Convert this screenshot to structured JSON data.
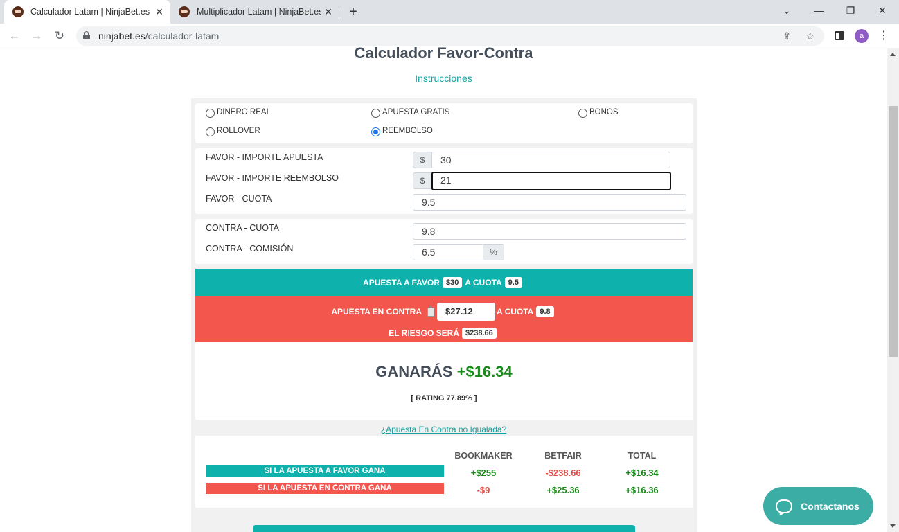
{
  "browser": {
    "tabs": [
      {
        "title": "Calculador Latam | NinjaBet.es",
        "close": "✕"
      },
      {
        "title": "Multiplicador Latam | NinjaBet.es",
        "close": "✕"
      }
    ],
    "new_tab": "+",
    "url_host": "ninjabet.es",
    "url_path": "/calculador-latam",
    "avatar_letter": "a"
  },
  "page": {
    "title": "Calculador Favor-Contra",
    "instructions_link": "Instrucciones",
    "bet_types": [
      {
        "label": "DINERO REAL",
        "checked": false
      },
      {
        "label": "APUESTA GRATIS",
        "checked": false
      },
      {
        "label": "BONOS",
        "checked": false
      },
      {
        "label": "ROLLOVER",
        "checked": false
      },
      {
        "label": "REEMBOLSO",
        "checked": true
      }
    ],
    "favor": {
      "stake_label": "FAVOR - IMPORTE APUESTA",
      "stake_prefix": "$",
      "stake_value": "30",
      "refund_label": "FAVOR - IMPORTE REEMBOLSO",
      "refund_prefix": "$",
      "refund_value": "21",
      "odds_label": "FAVOR - CUOTA",
      "odds_value": "9.5"
    },
    "contra": {
      "odds_label": "CONTRA - CUOTA",
      "odds_value": "9.8",
      "commission_label": "CONTRA - COMISIÓN",
      "commission_value": "6.5",
      "commission_suffix": "%"
    },
    "favor_bar": {
      "text1": "APUESTA A FAVOR",
      "stake": "$30",
      "text2": "A CUOTA",
      "odds": "9.5"
    },
    "contra_bar": {
      "text1": "APUESTA EN CONTRA",
      "stake": "$27.12",
      "text2": "A CUOTA",
      "odds": "9.8",
      "risk_text": "EL RIESGO SERÁ",
      "risk": "$238.66"
    },
    "result": {
      "win_text": "GANARÁS",
      "win_amount": "+$16.34",
      "rating": "[ RATING 77.89% ]"
    },
    "unmatched_link": "¿Apuesta En Contra no Igualada?",
    "summary": {
      "headers": [
        "BOOKMAKER",
        "BETFAIR",
        "TOTAL"
      ],
      "rows": [
        {
          "label": "SI LA APUESTA A FAVOR GANA",
          "bookmaker": "+$255",
          "betfair": "-$238.66",
          "total": "+$16.34"
        },
        {
          "label": "SI LA APUESTA EN CONTRA GANA",
          "bookmaker": "-$9",
          "betfair": "+$25.36",
          "total": "+$16.36"
        }
      ]
    },
    "contact_button": "Contactanos"
  },
  "colors": {
    "teal": "#0fb1ad",
    "coral": "#f2564c",
    "positive": "#1a8a1a",
    "negative": "#e2504a"
  }
}
